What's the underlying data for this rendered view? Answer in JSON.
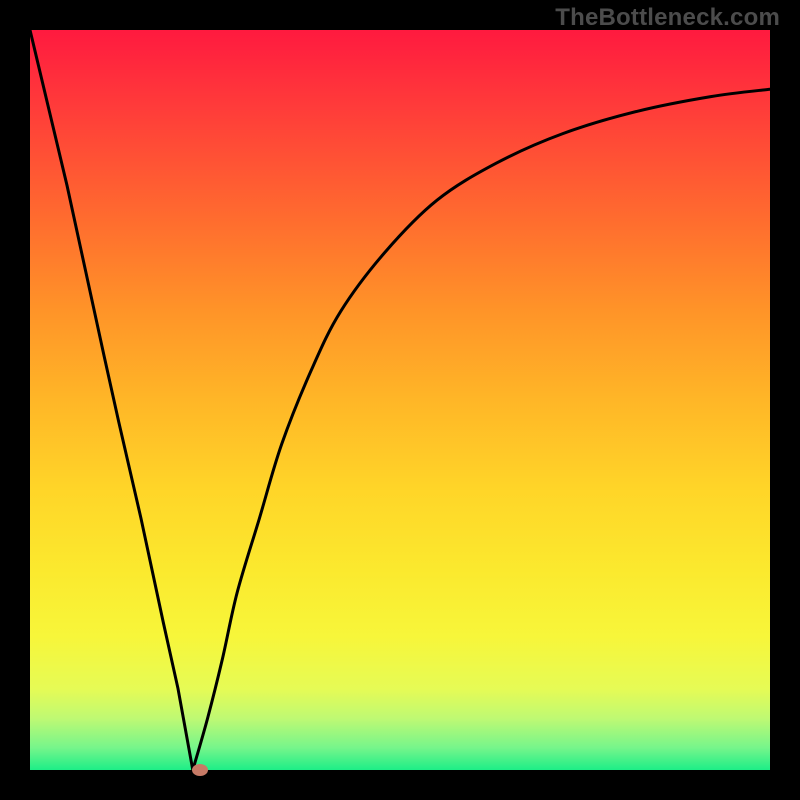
{
  "watermark": "TheBottleneck.com",
  "chart_data": {
    "type": "line",
    "title": "",
    "xlabel": "",
    "ylabel": "",
    "xlim": [
      0,
      100
    ],
    "ylim": [
      0,
      100
    ],
    "grid": false,
    "background_gradient": {
      "top_color": "#ff1a3f",
      "bottom_color": "#1dee87",
      "meaning": "red=high bottleneck, green=low bottleneck"
    },
    "vertex": {
      "x": 22,
      "y": 0
    },
    "marker": {
      "x": 23,
      "y": 0,
      "color": "#c77a66"
    },
    "series": [
      {
        "name": "bottleneck-curve",
        "x": [
          0,
          5,
          10,
          12,
          15,
          18,
          20,
          22,
          24,
          26,
          28,
          31,
          34,
          38,
          42,
          48,
          55,
          63,
          72,
          82,
          92,
          100
        ],
        "values": [
          100,
          79,
          56,
          47,
          34,
          20,
          11,
          0,
          7,
          15,
          24,
          34,
          44,
          54,
          62,
          70,
          77,
          82,
          86,
          89,
          91,
          92
        ]
      }
    ]
  }
}
